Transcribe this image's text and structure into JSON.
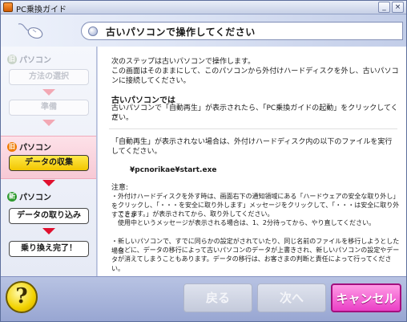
{
  "window": {
    "title": "PC乗換ガイド",
    "minimize_glyph": "_",
    "close_glyph": "×"
  },
  "header": {
    "title": "古いパソコンで操作してください"
  },
  "sidebar": {
    "old_pc_section": {
      "label": "パソコン"
    },
    "steps_old_a": [
      {
        "label": "方法の選択"
      },
      {
        "label": "準備"
      }
    ],
    "current_section": {
      "badge": "旧",
      "label": "パソコン"
    },
    "current_step": {
      "label": "データの収集"
    },
    "new_pc_section": {
      "badge": "新",
      "label": "パソコン"
    },
    "steps_new": [
      {
        "label": "データの取り込み"
      },
      {
        "label": "乗り換え完了！"
      }
    ]
  },
  "content": {
    "intro_line1": "次のステップは古いパソコンで操作します。",
    "intro_line2": "この画面はそのままにして、このパソコンから外付けハードディスクを外し、古いパソコ",
    "intro_line3": "ンに接続してください。",
    "heading": "古いパソコンでは",
    "instruction_line1": "古いパソコンで「自動再生」が表示されたら、「PC乗換ガイドの起動」をクリックしてくだ",
    "instruction_line2": "さい。",
    "fallback_line1": "「自動再生」が表示されない場合は、外付けハードディスク内の以下のファイルを実行",
    "fallback_line2": "してください。",
    "file_path": "¥pcnorikae¥start.exe",
    "note_heading": "注意:",
    "note1_line1": "・外付けハードディスクを外す時は、画面右下の通知領域にある「ハードウェアの安全な取り外し」を",
    "note1_line2": "　クリックし、「・・・を安全に取り外します」メッセージをクリックして、「・・・は安全に取り外すことが",
    "note1_line3": "　できます。」が表示されてから、取り外してください。",
    "note1_line4": "　使用中というメッセージが表示される場合は、1、2分待ってから、やり直してください。",
    "note2_line1": "・新しいパソコンで、すでに同らかの設定がされていたり、同じ名前のファイルを移行しようとした場合",
    "note2_line2": "　などに、データの移行によって古いパソコンのデータが上書きされ、新しいパソコンの設定やデータ",
    "note2_line3": "　が消えてしまうこともあります。データの移行は、お客さまの判断と責任によって行ってください。"
  },
  "footer": {
    "help_label": "?",
    "back_label": "戻る",
    "next_label": "次へ",
    "cancel_label": "キャンセル"
  },
  "colors": {
    "accent_pink": "#ea3fc6",
    "active_yellow": "#f2c600",
    "arrow_red": "#e0102e",
    "new_badge_green": "#2f9b2f",
    "old_badge_orange": "#f07a00",
    "frame_blue": "#98a6d2"
  },
  "icons": {
    "app": "app-icon",
    "header": "mouse-icon",
    "help": "help-icon"
  }
}
